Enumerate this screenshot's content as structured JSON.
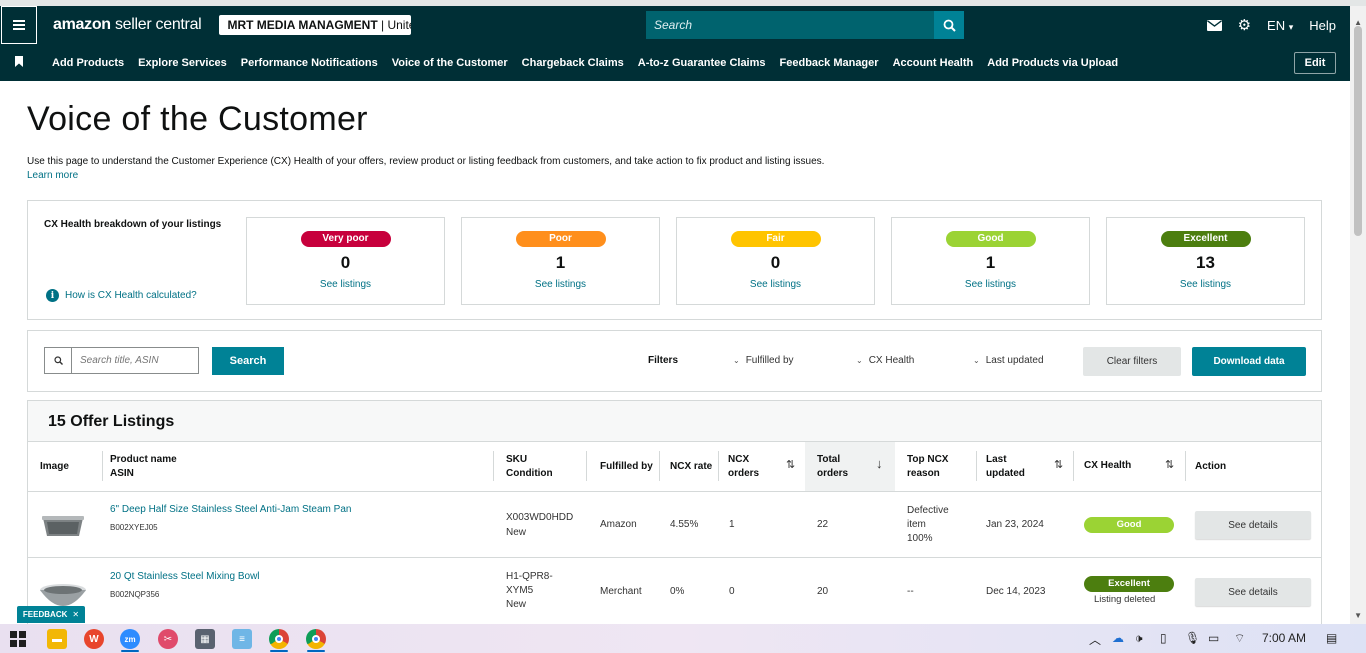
{
  "header": {
    "logo_main": "amazon",
    "logo_sub": "seller central",
    "store_name": "MRT MEDIA MANAGMENT",
    "store_region": " | Unite...",
    "search_placeholder": "Search",
    "language": "EN",
    "help": "Help"
  },
  "nav": {
    "items": [
      "Add Products",
      "Explore Services",
      "Performance Notifications",
      "Voice of the Customer",
      "Chargeback Claims",
      "A-to-z Guarantee Claims",
      "Feedback Manager",
      "Account Health",
      "Add Products via Upload"
    ],
    "edit": "Edit"
  },
  "page": {
    "title": "Voice of the Customer",
    "description": "Use this page to understand the Customer Experience (CX) Health of your offers, review product or listing feedback from customers, and take action to fix product and listing issues.",
    "learn_more": "Learn more"
  },
  "health": {
    "heading": "CX Health breakdown of your listings",
    "calc_link": "How is CX Health calculated?",
    "cards": [
      {
        "label": "Very poor",
        "count": "0",
        "link": "See listings",
        "color": "#c7003c",
        "text_color": "#ffffff"
      },
      {
        "label": "Poor",
        "count": "1",
        "link": "See listings",
        "color": "#ff8f1c",
        "text_color": "#ffffff"
      },
      {
        "label": "Fair",
        "count": "0",
        "link": "See listings",
        "color": "#ffc400",
        "text_color": "#ffffff"
      },
      {
        "label": "Good",
        "count": "1",
        "link": "See listings",
        "color": "#9bd334",
        "text_color": "#ffffff"
      },
      {
        "label": "Excellent",
        "count": "13",
        "link": "See listings",
        "color": "#4c7e0f",
        "text_color": "#ffffff"
      }
    ]
  },
  "filters": {
    "search_placeholder": "Search title, ASIN",
    "search_button": "Search",
    "label": "Filters",
    "fulfilled_by": "Fulfilled by",
    "cx_health": "CX Health",
    "last_updated": "Last updated",
    "clear": "Clear filters",
    "download": "Download data"
  },
  "listings": {
    "title": "15 Offer Listings",
    "columns": {
      "image": "Image",
      "product_name": "Product name",
      "asin": "ASIN",
      "sku": "SKU",
      "condition": "Condition",
      "fulfilled_by": "Fulfilled by",
      "ncx_rate": "NCX rate",
      "ncx_orders_1": "NCX",
      "ncx_orders_2": "orders",
      "total_orders_1": "Total",
      "total_orders_2": "orders",
      "top_ncx_1": "Top NCX",
      "top_ncx_2": "reason",
      "last_updated_1": "Last",
      "last_updated_2": "updated",
      "cx_health": "CX Health",
      "action": "Action"
    },
    "rows": [
      {
        "image_icon": "steam-pan-image",
        "product_name": "6\" Deep Half Size Stainless Steel Anti-Jam Steam Pan",
        "asin": "B002XYEJ05",
        "sku": "X003WD0HDD",
        "condition": "New",
        "fulfilled_by": "Amazon",
        "ncx_rate": "4.55%",
        "ncx_orders": "1",
        "total_orders": "22",
        "top_ncx_1": "Defective",
        "top_ncx_2": "item",
        "top_ncx_3": "100%",
        "last_updated": "Jan 23, 2024",
        "cx_health": "Good",
        "cx_color": "#9bd334",
        "cx_note": "",
        "action": "See details"
      },
      {
        "image_icon": "mixing-bowl-image",
        "product_name": "20 Qt Stainless Steel Mixing Bowl",
        "asin": "B002NQP356",
        "sku_1": "H1-QPR8-",
        "sku_2": "XYM5",
        "condition": "New",
        "fulfilled_by": "Merchant",
        "ncx_rate": "0%",
        "ncx_orders": "0",
        "total_orders": "20",
        "top_ncx": "--",
        "last_updated": "Dec 14, 2023",
        "cx_health": "Excellent",
        "cx_color": "#4c7e0f",
        "cx_note": "Listing deleted",
        "action": "See details"
      }
    ]
  },
  "feedback_tab": "FEEDBACK",
  "taskbar": {
    "time": "7:00 AM"
  }
}
